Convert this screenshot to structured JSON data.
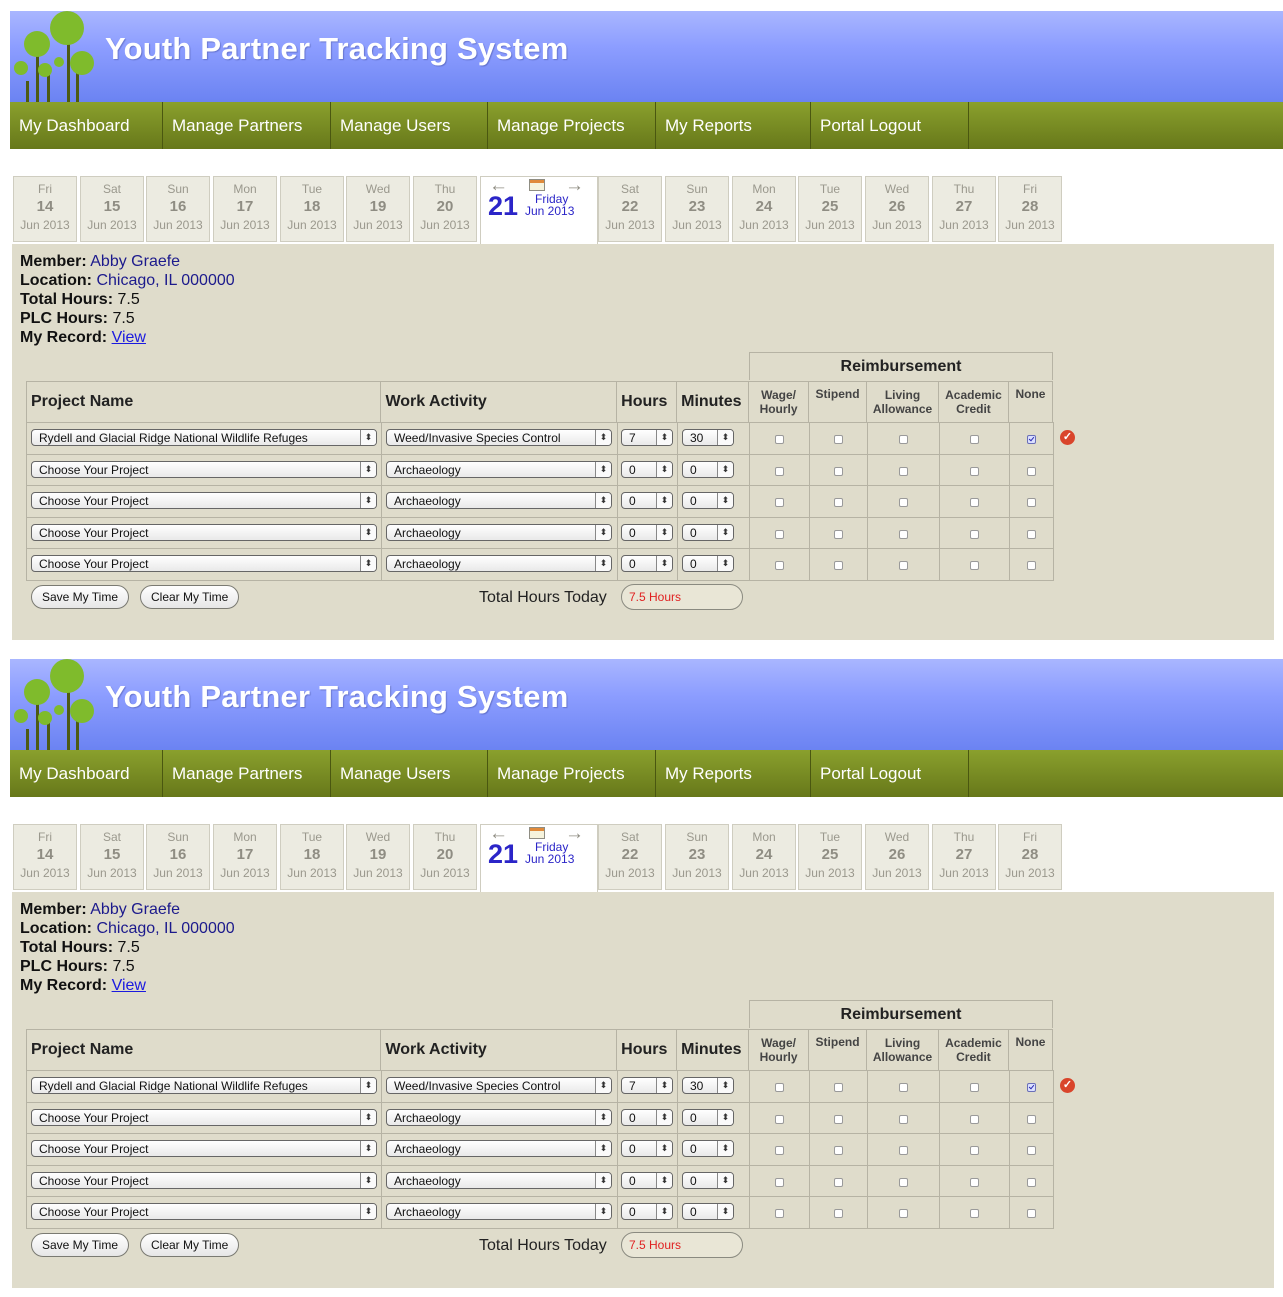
{
  "header": {
    "title": "Youth Partner Tracking System"
  },
  "nav": [
    {
      "label": "My Dashboard"
    },
    {
      "label": "Manage Partners"
    },
    {
      "label": "Manage Users"
    },
    {
      "label": "Manage Projects"
    },
    {
      "label": "My Reports"
    },
    {
      "label": "Portal Logout"
    }
  ],
  "date_tabs_before": [
    {
      "dow": "Fri",
      "day": "14",
      "month": "Jun 2013"
    },
    {
      "dow": "Sat",
      "day": "15",
      "month": "Jun 2013"
    },
    {
      "dow": "Sun",
      "day": "16",
      "month": "Jun 2013"
    },
    {
      "dow": "Mon",
      "day": "17",
      "month": "Jun 2013"
    },
    {
      "dow": "Tue",
      "day": "18",
      "month": "Jun 2013"
    },
    {
      "dow": "Wed",
      "day": "19",
      "month": "Jun 2013"
    },
    {
      "dow": "Thu",
      "day": "20",
      "month": "Jun 2013"
    }
  ],
  "active_date": {
    "day": "21",
    "dow": "Friday",
    "month": "Jun 2013",
    "prev_arrow": "←",
    "next_arrow": "→"
  },
  "date_tabs_after": [
    {
      "dow": "Sat",
      "day": "22",
      "month": "Jun 2013"
    },
    {
      "dow": "Sun",
      "day": "23",
      "month": "Jun 2013"
    },
    {
      "dow": "Mon",
      "day": "24",
      "month": "Jun 2013"
    },
    {
      "dow": "Tue",
      "day": "25",
      "month": "Jun 2013"
    },
    {
      "dow": "Wed",
      "day": "26",
      "month": "Jun 2013"
    },
    {
      "dow": "Thu",
      "day": "27",
      "month": "Jun 2013"
    },
    {
      "dow": "Fri",
      "day": "28",
      "month": "Jun 2013"
    }
  ],
  "member": {
    "member_label": "Member:",
    "member_value": "Abby Graefe",
    "location_label": "Location:",
    "location_value": "Chicago, IL 000000",
    "total_label": "Total Hours:",
    "total_value": "7.5",
    "plc_label": "PLC Hours:",
    "plc_value": "7.5",
    "record_label": "My Record:",
    "record_link": "View"
  },
  "table": {
    "headers": {
      "project": "Project Name",
      "activity": "Work Activity",
      "hours": "Hours",
      "minutes": "Minutes",
      "reimbursement": "Reimbursement"
    },
    "reimb_cols": [
      {
        "l1": "Wage/",
        "l2": "Hourly"
      },
      {
        "l1": "Stipend",
        "l2": ""
      },
      {
        "l1": "Living",
        "l2": "Allowance"
      },
      {
        "l1": "Academic",
        "l2": "Credit"
      },
      {
        "l1": "None",
        "l2": ""
      }
    ],
    "rows": [
      {
        "project": "Rydell and Glacial Ridge National Wildlife Refuges",
        "activity": "Weed/Invasive Species Control",
        "hours": "7",
        "minutes": "30",
        "checks": [
          false,
          false,
          false,
          false,
          true
        ],
        "saved": true
      },
      {
        "project": "Choose Your Project",
        "activity": "Archaeology",
        "hours": "0",
        "minutes": "0",
        "checks": [
          false,
          false,
          false,
          false,
          false
        ],
        "saved": false
      },
      {
        "project": "Choose Your Project",
        "activity": "Archaeology",
        "hours": "0",
        "minutes": "0",
        "checks": [
          false,
          false,
          false,
          false,
          false
        ],
        "saved": false
      },
      {
        "project": "Choose Your Project",
        "activity": "Archaeology",
        "hours": "0",
        "minutes": "0",
        "checks": [
          false,
          false,
          false,
          false,
          false
        ],
        "saved": false
      },
      {
        "project": "Choose Your Project",
        "activity": "Archaeology",
        "hours": "0",
        "minutes": "0",
        "checks": [
          false,
          false,
          false,
          false,
          false
        ],
        "saved": false
      }
    ]
  },
  "actions": {
    "save": "Save My Time",
    "clear": "Clear My Time"
  },
  "totals": {
    "label": "Total Hours Today",
    "value": "7.5 Hours"
  },
  "icons": {
    "saved": "check-circle-icon",
    "calendar": "calendar-icon",
    "dropdown": "updown-caret-icon"
  },
  "colors": {
    "banner": "#8c9dff",
    "nav": "#7a8c22",
    "content_bg": "#dfdccb",
    "link": "#1b1adf",
    "active_date": "#2b25c8",
    "total_value": "#e02020"
  }
}
